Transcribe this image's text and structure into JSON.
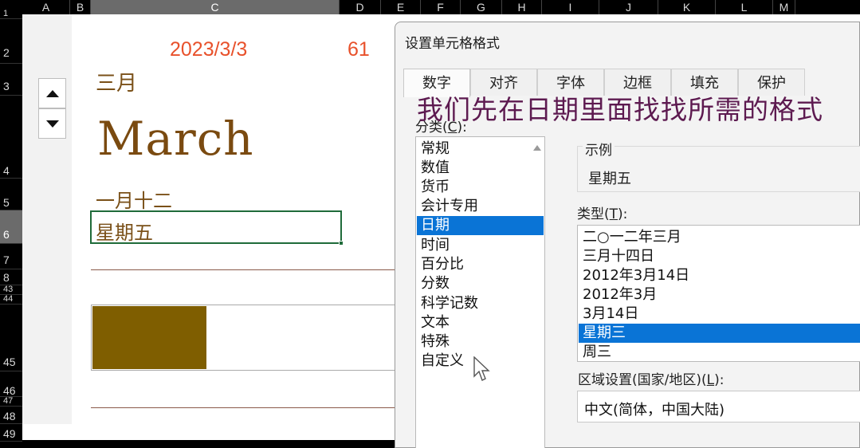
{
  "columns": [
    "A",
    "B",
    "C",
    "D",
    "E",
    "F",
    "G",
    "H",
    "I",
    "J",
    "K",
    "L",
    "M"
  ],
  "rows": [
    "1",
    "2",
    "3",
    "4",
    "5",
    "6",
    "7",
    "8",
    "43",
    "44",
    "45",
    "46",
    "47",
    "48",
    "49"
  ],
  "selected_row": "6",
  "sheet": {
    "date": "2023/3/3",
    "number": "61",
    "month_cn": "三月",
    "month_en": "March",
    "day_cn": "一月十二",
    "weekday": "星期五",
    "bar_fraction": 0.36,
    "colors": {
      "date": "#e8512b",
      "bar": "#7f5e00",
      "text": "#7a5018"
    }
  },
  "dialog": {
    "title": "设置单元格格式",
    "tabs": [
      "数字",
      "对齐",
      "字体",
      "边框",
      "填充",
      "保护"
    ],
    "active_tab": "数字",
    "category_label_prefix": "分类(",
    "category_label_key": "C",
    "category_label_suffix": "):",
    "categories": [
      "常规",
      "数值",
      "货币",
      "会计专用",
      "日期",
      "时间",
      "百分比",
      "分数",
      "科学记数",
      "文本",
      "特殊",
      "自定义"
    ],
    "selected_category": "日期",
    "sample_legend": "示例",
    "sample_value": "星期五",
    "type_label_prefix": "类型(",
    "type_label_key": "T",
    "type_label_suffix": "):",
    "types": [
      "二○一二年三月",
      "三月十四日",
      "2012年3月14日",
      "2012年3月",
      "3月14日",
      "星期三",
      "周三"
    ],
    "selected_type": "星期三",
    "locale_label_prefix": "区域设置(国家/地区)(",
    "locale_label_key": "L",
    "locale_label_suffix": "):",
    "locale_value": "中文(简体，中国大陆)"
  },
  "overlay_caption": "我们先在日期里面找找所需的格式",
  "icons": {
    "spin_up": "triangle-up-icon",
    "spin_down": "triangle-down-icon",
    "cursor": "mouse-pointer-icon"
  }
}
